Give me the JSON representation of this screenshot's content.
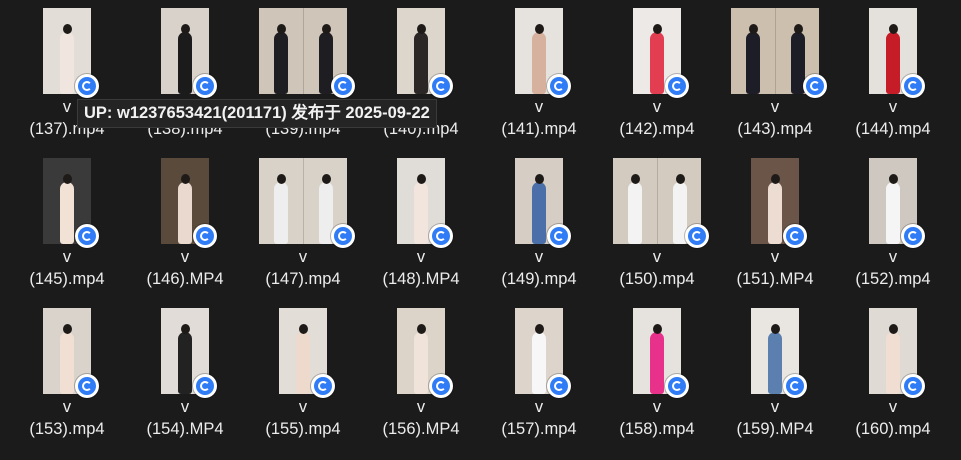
{
  "tooltip": {
    "text": "UP: w1237653421(201171) 发布于 2025-09-22"
  },
  "files": [
    {
      "line1": "v",
      "line2": "(137).mp4",
      "thumb": {
        "bg": "#e2ddd6",
        "tone": "#f0e6df",
        "split": false
      }
    },
    {
      "line1": "v",
      "line2": "(138).mp4",
      "thumb": {
        "bg": "#d8d2ca",
        "tone": "#1c1b1c",
        "split": false
      }
    },
    {
      "line1": "v",
      "line2": "(139).mp4",
      "thumb": {
        "bg": "#cfc5b8",
        "tone": "#1e1d22",
        "split": true
      }
    },
    {
      "line1": "v",
      "line2": "(140).mp4",
      "thumb": {
        "bg": "#ddd6cc",
        "tone": "#2b2727",
        "split": false
      }
    },
    {
      "line1": "v",
      "line2": "(141).mp4",
      "thumb": {
        "bg": "#e6e3df",
        "tone": "#d6b29e",
        "split": false
      }
    },
    {
      "line1": "v",
      "line2": "(142).mp4",
      "thumb": {
        "bg": "#ece9e6",
        "tone": "#e33d52",
        "split": false
      }
    },
    {
      "line1": "v",
      "line2": "(143).mp4",
      "thumb": {
        "bg": "#cdbfae",
        "tone": "#1d1d28",
        "split": true
      }
    },
    {
      "line1": "v",
      "line2": "(144).mp4",
      "thumb": {
        "bg": "#e4e0db",
        "tone": "#c61c27",
        "split": false
      }
    },
    {
      "line1": "v",
      "line2": "(145).mp4",
      "thumb": {
        "bg": "#3a3a3a",
        "tone": "#f2e1d5",
        "split": false
      }
    },
    {
      "line1": "v",
      "line2": "(146).MP4",
      "thumb": {
        "bg": "#5a4a3c",
        "tone": "#e9d9ce",
        "split": false
      }
    },
    {
      "line1": "v",
      "line2": "(147).mp4",
      "thumb": {
        "bg": "#d9d2c8",
        "tone": "#eeeeee",
        "split": true
      }
    },
    {
      "line1": "v",
      "line2": "(148).MP4",
      "thumb": {
        "bg": "#e0ddd8",
        "tone": "#f1e5de",
        "split": false
      }
    },
    {
      "line1": "v",
      "line2": "(149).mp4",
      "thumb": {
        "bg": "#d6cec4",
        "tone": "#4b6fa8",
        "split": false
      }
    },
    {
      "line1": "v",
      "line2": "(150).mp4",
      "thumb": {
        "bg": "#d3cbc0",
        "tone": "#f3f3f3",
        "split": true
      }
    },
    {
      "line1": "v",
      "line2": "(151).MP4",
      "thumb": {
        "bg": "#6a5548",
        "tone": "#eddcd1",
        "split": false
      }
    },
    {
      "line1": "v",
      "line2": "(152).mp4",
      "thumb": {
        "bg": "#cfc8c0",
        "tone": "#f5f5f5",
        "split": false
      }
    },
    {
      "line1": "v",
      "line2": "(153).mp4",
      "thumb": {
        "bg": "#d9d3cb",
        "tone": "#f2dfd3",
        "split": false
      }
    },
    {
      "line1": "v",
      "line2": "(154).MP4",
      "thumb": {
        "bg": "#e1dcd7",
        "tone": "#222222",
        "split": false
      }
    },
    {
      "line1": "v",
      "line2": "(155).mp4",
      "thumb": {
        "bg": "#e2ddd6",
        "tone": "#eedacd",
        "split": false
      }
    },
    {
      "line1": "v",
      "line2": "(156).MP4",
      "thumb": {
        "bg": "#dcd4c8",
        "tone": "#efe3da",
        "split": false
      }
    },
    {
      "line1": "v",
      "line2": "(157).mp4",
      "thumb": {
        "bg": "#ddd5cb",
        "tone": "#f7f7f7",
        "split": false
      }
    },
    {
      "line1": "v",
      "line2": "(158).mp4",
      "thumb": {
        "bg": "#e6e2dd",
        "tone": "#e8318a",
        "split": false
      }
    },
    {
      "line1": "v",
      "line2": "(159).MP4",
      "thumb": {
        "bg": "#e9e6e2",
        "tone": "#5b7fae",
        "split": false
      }
    },
    {
      "line1": "v",
      "line2": "(160).mp4",
      "thumb": {
        "bg": "#dfdad4",
        "tone": "#f0ded2",
        "split": false
      }
    }
  ]
}
